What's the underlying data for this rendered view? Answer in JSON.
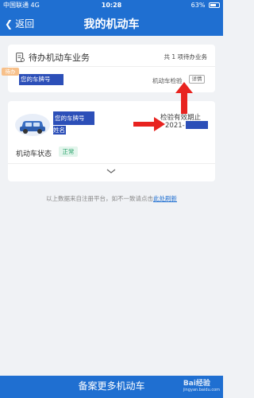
{
  "status_bar": {
    "carrier": "中国联通",
    "network": "4G",
    "time": "10:28",
    "battery": "63%"
  },
  "nav": {
    "back_label": "返回",
    "title": "我的机动车"
  },
  "pending": {
    "title": "待办机动车业务",
    "count_text": "共 1 项待办业务",
    "tag": "待办",
    "plate": "您的车牌号",
    "type": "机动车检验",
    "detail_label": "详情"
  },
  "vehicle": {
    "plate": "您的车牌号",
    "owner": "姓名",
    "inspection_label": "检验有效期止",
    "inspection_date": "2021-",
    "status_label": "机动车状态",
    "status_value": "正常"
  },
  "footnote": {
    "text": "以上数据来自注册平台，如不一致请点击",
    "link": "此处刷新"
  },
  "bottom_button": {
    "label": "备案更多机动车"
  },
  "watermark": {
    "text": "Bai经验",
    "sub": "jingyan.baidu.com"
  },
  "colors": {
    "primary": "#1f6fd1",
    "mask": "#2c4fb8",
    "arrow": "#e8231f",
    "status_green": "#2aa36b",
    "pending_tag": "#f7c08a"
  }
}
